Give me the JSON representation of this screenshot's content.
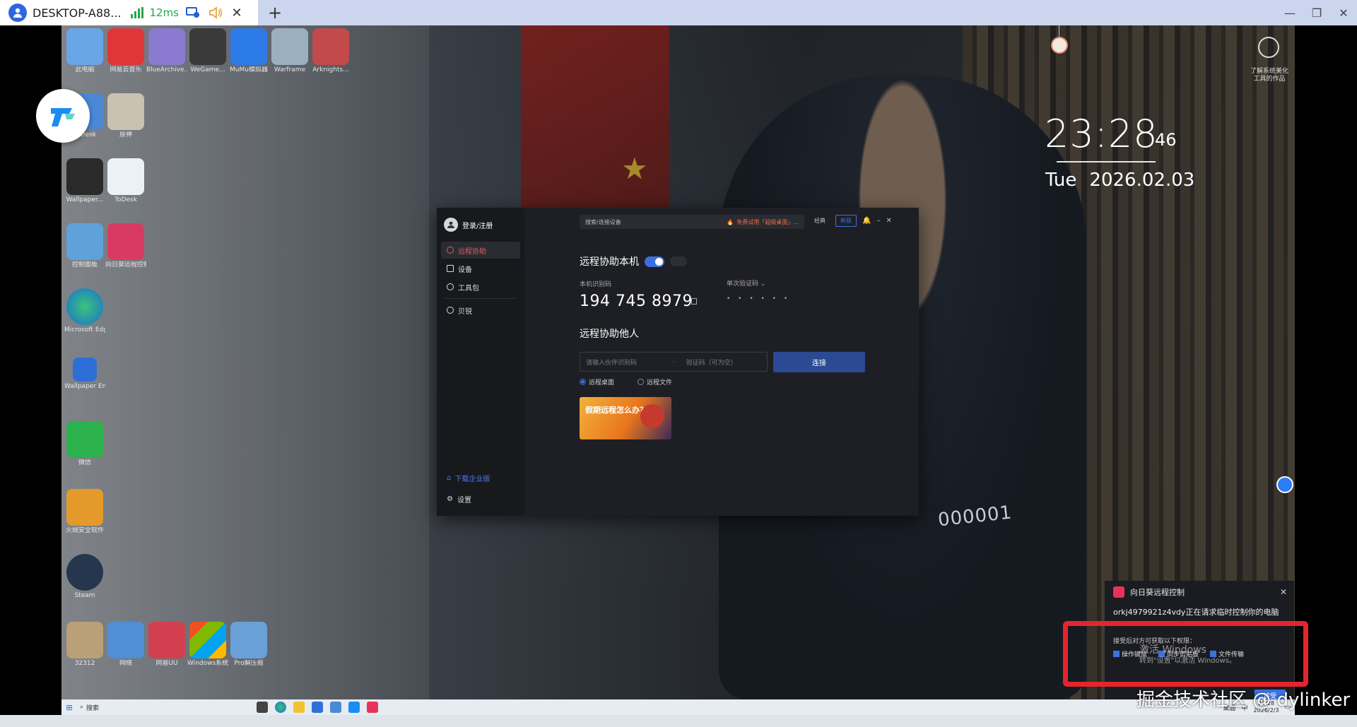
{
  "client": {
    "host": "DESKTOP-A88...",
    "latency": "12ms",
    "add_tab": "+",
    "tab_close": "✕",
    "window_controls": [
      "—",
      "❐",
      "✕"
    ]
  },
  "desktop_icons": [
    {
      "label": "此电脑"
    },
    {
      "label": "网易云音乐"
    },
    {
      "label": "BlueArchive..."
    },
    {
      "label": "WeGame..."
    },
    {
      "label": "MuMu模拟器"
    },
    {
      "label": "Warframe"
    },
    {
      "label": "Arknights..."
    },
    {
      "label": "ToDesk"
    },
    {
      "label": "原神"
    },
    {
      "label": "Wallpaper..."
    },
    {
      "label": "ToDesk"
    },
    {
      "label": "控制面板"
    },
    {
      "label": "向日葵远程控制"
    },
    {
      "label": "Microsoft Edge"
    },
    {
      "label": "Wallpaper Engine..."
    },
    {
      "label": "微信"
    },
    {
      "label": "火绒安全软件"
    },
    {
      "label": "Steam"
    },
    {
      "label": "32312"
    },
    {
      "label": "网络"
    },
    {
      "label": "网易UU"
    },
    {
      "label": "Windows系统..."
    },
    {
      "label": "Pro解压缩"
    }
  ],
  "clock": {
    "time": "23:28",
    "seconds": "46",
    "weekday": "Tue",
    "date": "2026.02.03"
  },
  "profile_text": "了解系统美化工具的作品",
  "todesk": {
    "login": "登录/注册",
    "nav": [
      {
        "label": "远程协助",
        "active": true
      },
      {
        "label": "设备",
        "active": false
      },
      {
        "label": "工具包",
        "active": false
      },
      {
        "label": "贝锐",
        "active": false
      }
    ],
    "enterprise": "下载企业版",
    "settings": "设置",
    "search_placeholder": "搜索/连接设备",
    "promo": "免费试用「超级桌面」...",
    "top_buttons": [
      "经典",
      "新版"
    ],
    "section1_title": "远程协助本机",
    "id_label": "本机识别码",
    "id_code": "194 745 8979",
    "pass_label": "单次验证码",
    "pass_dots": "• • • • • •",
    "section2_title": "远程协助他人",
    "partner_placeholder": "请输入伙伴识别码",
    "verify_placeholder": "验证码（可为空）",
    "dash": "-",
    "connect": "连接",
    "radio_desktop": "远程桌面",
    "radio_file": "远程文件",
    "banner_text": "假期远程怎么办？"
  },
  "notify": {
    "title": "向日葵远程控制",
    "message": "orkj4979921z4vdy正在请求临时控制你的电脑",
    "perm_label": "接受后对方可获取以下权限：",
    "perms": [
      "操作键鼠",
      "同步剪贴板",
      "文件传输"
    ],
    "accept": "接受",
    "close": "✕"
  },
  "activate": {
    "line1": "激活 Windows",
    "line2": "转到\"设置\"以激活 Windows。"
  },
  "taskbar": {
    "search": "搜索",
    "tray_label": "桌面",
    "time": "23:28",
    "date": "2026/2/3",
    "ime": "中"
  },
  "watermark": "掘金技术社区 @ dylinker",
  "colors": {
    "accent_blue": "#3b72e0",
    "active_red": "#e25c5c",
    "highlight_red": "#e4252d",
    "latency_green": "#22a74b"
  }
}
